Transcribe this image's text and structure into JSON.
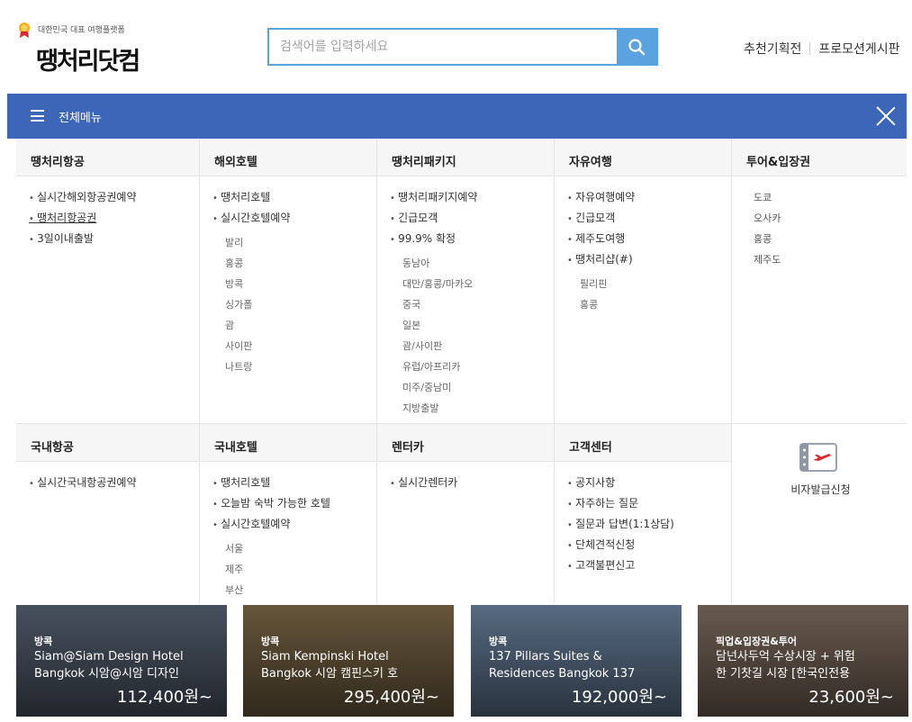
{
  "header": {
    "tagline": "대한민국 대표 여행플랫폼",
    "logo_text": "땡처리닷컴",
    "search_placeholder": "검색어를 입력하세요",
    "links": [
      "추천기획전",
      "프로모션게시판"
    ]
  },
  "menubar": {
    "title": "전체메뉴"
  },
  "columns_row1": [
    {
      "heading": "땡처리항공",
      "items": [
        {
          "label": "실시간해외항공권예약",
          "type": "bullet"
        },
        {
          "label": "땡처리항공권",
          "type": "bullet",
          "underline": true
        },
        {
          "label": "3일이내출발",
          "type": "bullet"
        }
      ]
    },
    {
      "heading": "해외호텔",
      "items": [
        {
          "label": "땡처리호텔",
          "type": "bullet"
        },
        {
          "label": "실시간호텔예약",
          "type": "bullet"
        },
        {
          "label": "발리",
          "type": "sub"
        },
        {
          "label": "홍콩",
          "type": "sub"
        },
        {
          "label": "방콕",
          "type": "sub"
        },
        {
          "label": "싱가폴",
          "type": "sub"
        },
        {
          "label": "괌",
          "type": "sub"
        },
        {
          "label": "사이판",
          "type": "sub"
        },
        {
          "label": "나트랑",
          "type": "sub"
        }
      ]
    },
    {
      "heading": "땡처리패키지",
      "items": [
        {
          "label": "땡처리패키지예약",
          "type": "bullet"
        },
        {
          "label": "긴급모객",
          "type": "bullet"
        },
        {
          "label": "99.9% 확정",
          "type": "bullet"
        },
        {
          "label": "동남아",
          "type": "sub"
        },
        {
          "label": "대만/홍콩/마카오",
          "type": "sub"
        },
        {
          "label": "중국",
          "type": "sub"
        },
        {
          "label": "일본",
          "type": "sub"
        },
        {
          "label": "괌/사이판",
          "type": "sub"
        },
        {
          "label": "유럽/아프리카",
          "type": "sub"
        },
        {
          "label": "미주/중남미",
          "type": "sub"
        },
        {
          "label": "지방출발",
          "type": "sub"
        }
      ]
    },
    {
      "heading": "자유여행",
      "items": [
        {
          "label": "자유여행예약",
          "type": "bullet"
        },
        {
          "label": "긴급모객",
          "type": "bullet"
        },
        {
          "label": "제주도여행",
          "type": "bullet"
        },
        {
          "label": "땡처리샵(#)",
          "type": "bullet"
        },
        {
          "label": "필리핀",
          "type": "sub"
        },
        {
          "label": "홍콩",
          "type": "sub"
        }
      ]
    },
    {
      "heading": "투어&입장권",
      "items": [
        {
          "label": "도쿄",
          "type": "plain"
        },
        {
          "label": "오사카",
          "type": "plain"
        },
        {
          "label": "홍콩",
          "type": "plain"
        },
        {
          "label": "제주도",
          "type": "plain"
        }
      ]
    }
  ],
  "columns_row2": [
    {
      "heading": "국내항공",
      "items": [
        {
          "label": "실시간국내항공권예약",
          "type": "bullet"
        }
      ]
    },
    {
      "heading": "국내호텔",
      "items": [
        {
          "label": "땡처리호텔",
          "type": "bullet"
        },
        {
          "label": "오늘밤 숙박 가능한 호텔",
          "type": "bullet"
        },
        {
          "label": "실시간호텔예약",
          "type": "bullet"
        },
        {
          "label": "서울",
          "type": "sub"
        },
        {
          "label": "제주",
          "type": "sub"
        },
        {
          "label": "부산",
          "type": "sub"
        }
      ]
    },
    {
      "heading": "렌터카",
      "items": [
        {
          "label": "실시간렌터카",
          "type": "bullet"
        }
      ]
    },
    {
      "heading": "고객센터",
      "items": [
        {
          "label": "공지사항",
          "type": "bullet"
        },
        {
          "label": "자주하는 질문",
          "type": "bullet"
        },
        {
          "label": "질문과 답변(1:1상담)",
          "type": "bullet"
        },
        {
          "label": "단체견적신청",
          "type": "bullet"
        },
        {
          "label": "고객불편신고",
          "type": "bullet"
        }
      ]
    }
  ],
  "visa": {
    "label": "비자발급신청",
    "icon": "passport-plane-icon"
  },
  "cards": [
    {
      "category": "방콕",
      "title_1": "Siam@Siam Design Hotel",
      "title_2": "Bangkok 시암@시암 디자인",
      "price": "112,400원~",
      "bg": "#4b5563"
    },
    {
      "category": "방콕",
      "title_1": "Siam Kempinski Hotel",
      "title_2": "Bangkok 시암 캠핀스키 호",
      "price": "295,400원~",
      "bg": "#6b5a3e"
    },
    {
      "category": "방콕",
      "title_1": "137 Pillars Suites &",
      "title_2": "Residences Bangkok 137",
      "price": "192,000원~",
      "bg": "#5b7088"
    },
    {
      "category": "픽업&입장권&투어",
      "title_1": "담넌사두억 수상시장 + 위험",
      "title_2": "한 기찻길 시장 [한국인전용",
      "price": "23,600원~",
      "bg": "#6e5e52"
    }
  ],
  "colors": {
    "accent": "#3c66b8",
    "search_blue": "#5aa3e0"
  }
}
